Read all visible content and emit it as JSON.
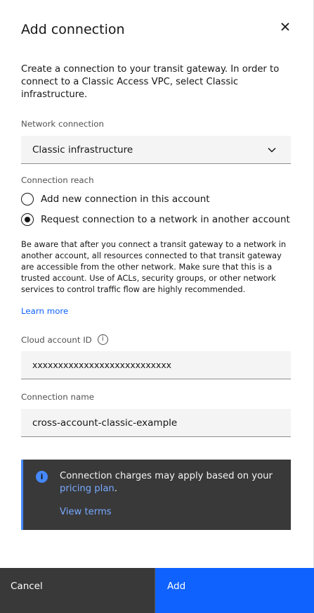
{
  "modal": {
    "title": "Add connection",
    "description": "Create a connection to your transit gateway. In order to connect to a Classic Access VPC, select Classic infrastructure."
  },
  "network_connection": {
    "label": "Network connection",
    "selected": "Classic infrastructure"
  },
  "connection_reach": {
    "label": "Connection reach",
    "options": [
      {
        "label": "Add new connection in this account",
        "checked": false
      },
      {
        "label": "Request connection to a network in another account",
        "checked": true
      }
    ],
    "warning": "Be aware that after you connect a transit gateway to a network in another account, all resources connected to that transit gateway are accessible from the other network. Make sure that this is a trusted account. Use of ACLs, security groups, or other network services to control traffic flow are highly recommended.",
    "learn_more": "Learn more"
  },
  "cloud_account": {
    "label": "Cloud account ID",
    "value": "xxxxxxxxxxxxxxxxxxxxxxxxxxx"
  },
  "connection_name": {
    "label": "Connection name",
    "value": "cross-account-classic-example"
  },
  "notification": {
    "text_before": "Connection charges may apply based on your ",
    "link": "pricing plan",
    "text_after": ".",
    "view_terms": "View terms"
  },
  "footer": {
    "cancel": "Cancel",
    "add": "Add"
  },
  "colors": {
    "primary": "#0f62fe",
    "notification_bg": "#393939",
    "notification_accent": "#4589ff",
    "link": "#0f62fe"
  },
  "icons": {
    "close": "close-icon",
    "chevron": "chevron-down-icon",
    "info": "info-icon",
    "notification": "info-filled-icon"
  }
}
